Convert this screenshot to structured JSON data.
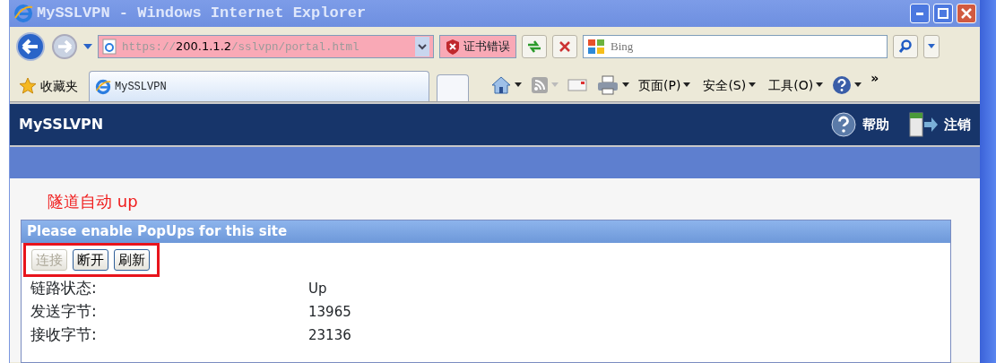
{
  "window": {
    "title": "MySSLVPN - Windows Internet Explorer"
  },
  "address_bar": {
    "scheme": "https://",
    "host": "200.1.1.2",
    "path": "/sslvpn/portal.html",
    "certificate_error": true,
    "certificate_label": "证书错误"
  },
  "search": {
    "placeholder": "Bing"
  },
  "favorites": {
    "label": "收藏夹"
  },
  "tabs": [
    {
      "label": "MySSLVPN",
      "selected": true
    }
  ],
  "command_menus": [
    {
      "label": "页面(P)"
    },
    {
      "label": "安全(S)"
    },
    {
      "label": "工具(O)"
    }
  ],
  "more_label": "»",
  "page": {
    "brand": "MySSLVPN",
    "header_links": [
      {
        "label": "帮助"
      },
      {
        "label": "注销"
      }
    ],
    "notice": "隧道自动 up",
    "panel": {
      "title": "Please enable PopUps for this site",
      "buttons_highlighted": true,
      "buttons": [
        {
          "label": "连接",
          "disabled": true
        },
        {
          "label": "断开",
          "disabled": false
        },
        {
          "label": "刷新",
          "disabled": false
        }
      ],
      "rows": [
        {
          "label": "链路状态:",
          "value": "Up"
        },
        {
          "label": "发送字节:",
          "value": "13965"
        },
        {
          "label": "接收字节:",
          "value": "23136"
        }
      ]
    }
  }
}
